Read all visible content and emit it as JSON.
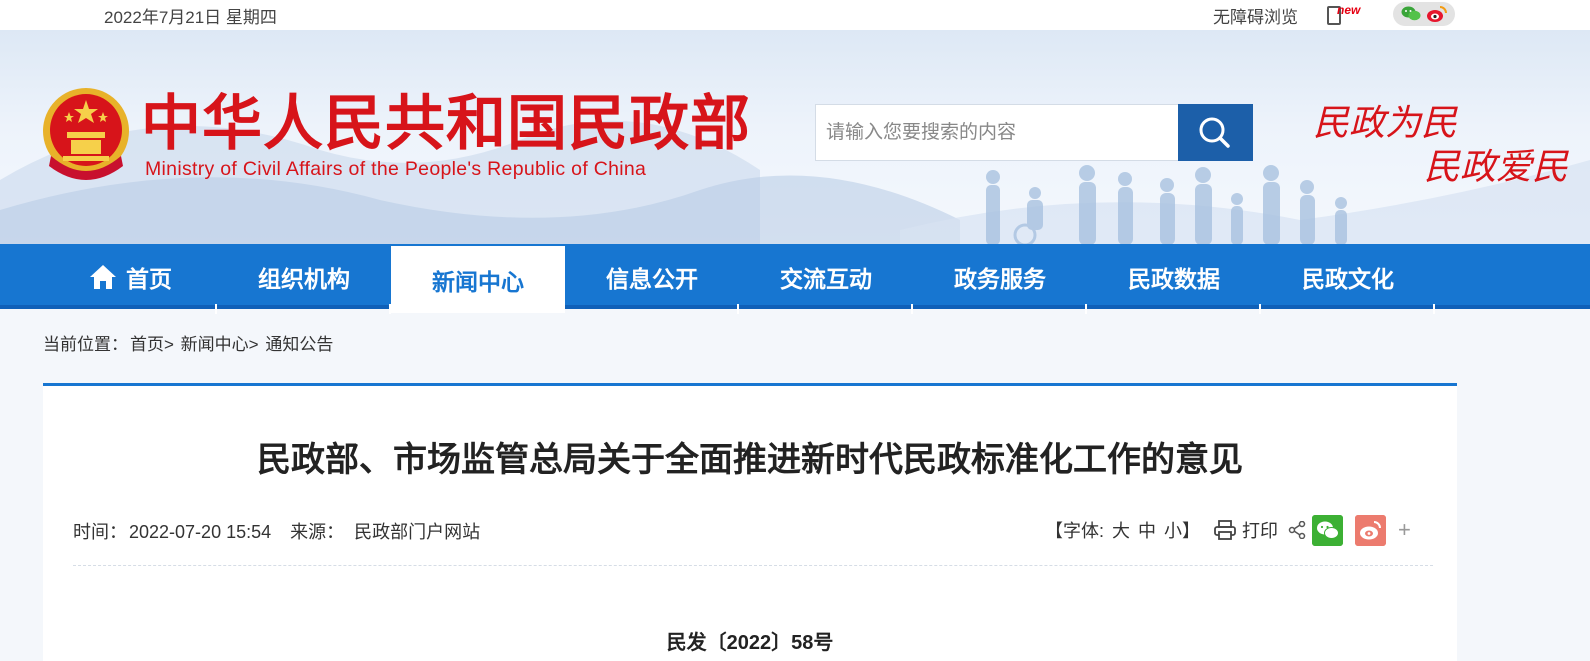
{
  "topbar": {
    "date": "2022年7月21日 星期四",
    "accessibility": "无障碍浏览",
    "mobile_badge": "new"
  },
  "header": {
    "title_cn": "中华人民共和国民政部",
    "title_en": "Ministry of Civil Affairs of the People's Republic of China",
    "slogan_line1": "民政为民",
    "slogan_line2": "民政爱民"
  },
  "search": {
    "placeholder": "请输入您要搜索的内容"
  },
  "nav": {
    "items": [
      {
        "label": "首页"
      },
      {
        "label": "组织机构"
      },
      {
        "label": "新闻中心"
      },
      {
        "label": "信息公开"
      },
      {
        "label": "交流互动"
      },
      {
        "label": "政务服务"
      },
      {
        "label": "民政数据"
      },
      {
        "label": "民政文化"
      }
    ],
    "active_index": 2
  },
  "breadcrumb": {
    "prefix": "当前位置：",
    "items": [
      "首页>",
      "新闻中心>",
      "通知公告"
    ]
  },
  "article": {
    "title": "民政部、市场监管总局关于全面推进新时代民政标准化工作的意见",
    "time_label": "时间：",
    "time": "2022-07-20 15:54",
    "source_label": "来源：",
    "source": "民政部门户网站",
    "font_label": "【字体:",
    "font_large": "大",
    "font_medium": "中",
    "font_small": "小】",
    "print": "打印",
    "doc_number": "民发〔2022〕58号"
  },
  "colors": {
    "brand_red": "#d7141a",
    "nav_blue": "#1776d1",
    "search_blue": "#1c5fa9"
  }
}
